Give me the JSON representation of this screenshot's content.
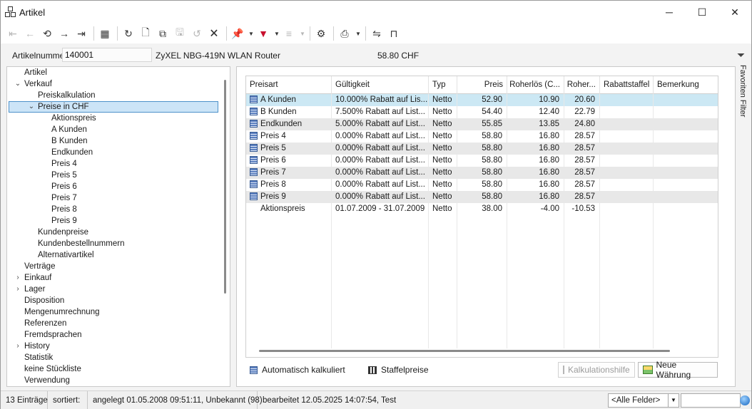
{
  "window": {
    "title": "Artikel",
    "controls": {
      "minimize": "─",
      "maximize": "☐",
      "close": "✕"
    }
  },
  "toolbar": {
    "buttons": [
      {
        "name": "first-record-icon",
        "glyph": "⇤",
        "enabled": false
      },
      {
        "name": "previous-record-icon",
        "glyph": "←",
        "enabled": false
      },
      {
        "name": "history-icon",
        "glyph": "⟲",
        "enabled": true
      },
      {
        "name": "next-record-icon",
        "glyph": "→",
        "enabled": true
      },
      {
        "name": "last-record-icon",
        "glyph": "⇥",
        "enabled": true
      },
      {
        "name": "table-view-icon",
        "glyph": "▦",
        "enabled": true
      },
      {
        "name": "refresh-icon",
        "glyph": "↻",
        "enabled": true
      },
      {
        "name": "new-document-icon",
        "glyph": "🗋",
        "enabled": true
      },
      {
        "name": "copy-icon",
        "glyph": "⧉",
        "enabled": true
      },
      {
        "name": "save-icon",
        "glyph": "🖫",
        "enabled": false
      },
      {
        "name": "undo-icon",
        "glyph": "↺",
        "enabled": false
      },
      {
        "name": "delete-icon",
        "glyph": "🗙",
        "enabled": true
      },
      {
        "name": "pin-icon",
        "glyph": "📌",
        "enabled": true
      },
      {
        "name": "filter-icon",
        "glyph": "▼",
        "enabled": true
      },
      {
        "name": "tree-icon",
        "glyph": "≡",
        "enabled": false
      },
      {
        "name": "settings-icon",
        "glyph": "⚙",
        "enabled": true
      },
      {
        "name": "print-icon",
        "glyph": "⎙",
        "enabled": true
      },
      {
        "name": "link-icon",
        "glyph": "⇋",
        "enabled": true
      },
      {
        "name": "bookmark-icon",
        "glyph": "⊓",
        "enabled": true
      }
    ]
  },
  "header": {
    "artnr_label": "Artikelnummer",
    "artnr_value": "140001",
    "article_name": "ZyXEL NBG-419N WLAN Router",
    "price": "58.80  CHF"
  },
  "side_panel": {
    "label": "Favoriten Filter"
  },
  "tree": {
    "items": [
      {
        "label": "Artikel",
        "level": 0,
        "arrow": ""
      },
      {
        "label": "Verkauf",
        "level": 0,
        "arrow": "⌄"
      },
      {
        "label": "Preiskalkulation",
        "level": 1,
        "arrow": ""
      },
      {
        "label": "Preise in CHF",
        "level": 1,
        "arrow": "⌄",
        "selected": true
      },
      {
        "label": "Aktionspreis",
        "level": 2,
        "arrow": ""
      },
      {
        "label": "A Kunden",
        "level": 2,
        "arrow": ""
      },
      {
        "label": "B Kunden",
        "level": 2,
        "arrow": ""
      },
      {
        "label": "Endkunden",
        "level": 2,
        "arrow": ""
      },
      {
        "label": "Preis 4",
        "level": 2,
        "arrow": ""
      },
      {
        "label": "Preis 5",
        "level": 2,
        "arrow": ""
      },
      {
        "label": "Preis 6",
        "level": 2,
        "arrow": ""
      },
      {
        "label": "Preis 7",
        "level": 2,
        "arrow": ""
      },
      {
        "label": "Preis 8",
        "level": 2,
        "arrow": ""
      },
      {
        "label": "Preis 9",
        "level": 2,
        "arrow": ""
      },
      {
        "label": "Kundenpreise",
        "level": 1,
        "arrow": ""
      },
      {
        "label": "Kundenbestellnummern",
        "level": 1,
        "arrow": ""
      },
      {
        "label": "Alternativartikel",
        "level": 1,
        "arrow": ""
      },
      {
        "label": "Verträge",
        "level": 0,
        "arrow": ""
      },
      {
        "label": "Einkauf",
        "level": 0,
        "arrow": "›"
      },
      {
        "label": "Lager",
        "level": 0,
        "arrow": "›"
      },
      {
        "label": "Disposition",
        "level": 0,
        "arrow": ""
      },
      {
        "label": "Mengenumrechnung",
        "level": 0,
        "arrow": ""
      },
      {
        "label": "Referenzen",
        "level": 0,
        "arrow": ""
      },
      {
        "label": "Fremdsprachen",
        "level": 0,
        "arrow": ""
      },
      {
        "label": "History",
        "level": 0,
        "arrow": "›"
      },
      {
        "label": "Statistik",
        "level": 0,
        "arrow": ""
      },
      {
        "label": "keine Stückliste",
        "level": 0,
        "arrow": ""
      },
      {
        "label": "Verwendung",
        "level": 0,
        "arrow": ""
      }
    ]
  },
  "grid": {
    "columns": [
      "Preisart",
      "Gültigkeit",
      "Typ",
      "Preis",
      "Roherlös (C...",
      "Roher...",
      "Rabattstaffel",
      "Bemerkung"
    ],
    "rows": [
      {
        "icon": true,
        "cells": [
          "A Kunden",
          "10.000% Rabatt auf Lis...",
          "Netto",
          "52.90",
          "10.90",
          "20.60",
          "",
          ""
        ]
      },
      {
        "icon": true,
        "cells": [
          "B Kunden",
          "7.500% Rabatt auf List...",
          "Netto",
          "54.40",
          "12.40",
          "22.79",
          "",
          ""
        ]
      },
      {
        "icon": true,
        "cells": [
          "Endkunden",
          "5.000% Rabatt auf List...",
          "Netto",
          "55.85",
          "13.85",
          "24.80",
          "",
          ""
        ]
      },
      {
        "icon": true,
        "cells": [
          "Preis 4",
          "0.000% Rabatt auf List...",
          "Netto",
          "58.80",
          "16.80",
          "28.57",
          "",
          ""
        ]
      },
      {
        "icon": true,
        "cells": [
          "Preis 5",
          "0.000% Rabatt auf List...",
          "Netto",
          "58.80",
          "16.80",
          "28.57",
          "",
          ""
        ]
      },
      {
        "icon": true,
        "cells": [
          "Preis 6",
          "0.000% Rabatt auf List...",
          "Netto",
          "58.80",
          "16.80",
          "28.57",
          "",
          ""
        ]
      },
      {
        "icon": true,
        "cells": [
          "Preis 7",
          "0.000% Rabatt auf List...",
          "Netto",
          "58.80",
          "16.80",
          "28.57",
          "",
          ""
        ]
      },
      {
        "icon": true,
        "cells": [
          "Preis 8",
          "0.000% Rabatt auf List...",
          "Netto",
          "58.80",
          "16.80",
          "28.57",
          "",
          ""
        ]
      },
      {
        "icon": true,
        "cells": [
          "Preis 9",
          "0.000% Rabatt auf List...",
          "Netto",
          "58.80",
          "16.80",
          "28.57",
          "",
          ""
        ]
      },
      {
        "icon": false,
        "cells": [
          "Aktionspreis",
          "01.07.2009 - 31.07.2009",
          "Netto",
          "38.00",
          "-4.00",
          "-10.53",
          "",
          ""
        ]
      }
    ],
    "empty_rows": 11,
    "colors": {
      "selected": "#cce8f4",
      "striped": "#e8e8e8",
      "plain": "#ffffff"
    }
  },
  "footer": {
    "auto_calc_label": "Automatisch kalkuliert",
    "staffel_label": "Staffelpreise",
    "calc_help_button": "Kalkulationshilfe",
    "new_currency_button": "Neue Währung"
  },
  "statusbar": {
    "count": "13 Einträge",
    "sorted": "sortiert:",
    "created": "angelegt 01.05.2008 09:51:11, Unbekannt (98)",
    "edited": "bearbeitet 12.05.2025 14:07:54, Test",
    "field_select": "<Alle Felder>"
  }
}
